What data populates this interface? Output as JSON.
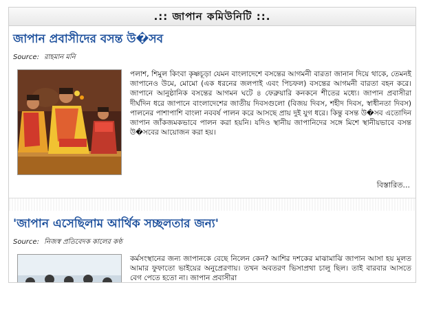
{
  "section": {
    "title": ".:: জাপান কমিউনিটি ::."
  },
  "articles": [
    {
      "title": "জাপান প্রবাসীদের বসন্ত উ�সব",
      "source_label": "Source:",
      "source_name": "রাহমান মনি",
      "body": "পলাশ, শিমুল কিংবা কৃষ্ণচূড়া যেমন বাংলাদেশে বসন্তের আগমনী বারতা জানান দিয়ে থাকে, তেমনই জাপানেও উমে, মোমো (এক ধরনের জলপাই এবং পিচফল) বসন্তের আগমনী বারতা বহন করে। জাপানে আনুষ্ঠানিক বসন্তের আগমন ঘটে ৪ ফেব্রুয়ারি কনকনে শীতের মধ্যে। জাপান প্রবাসীরা দীর্ঘদিন ধরে জাপানে বাংলাদেশের জাতীয় দিবসগুলো (বিজয় দিবস, শহীদ দিবস, স্বাধীনতা দিবস) পালনের পাশাপাশি বাংলা নববর্ষ পালন করে আসছে প্রায় দুই যুগ ধরে। কিন্তু বসন্ত উ�সব এতোদিন জাপান জাঁকজমকভাবে পালন করা হয়নি। যদিও স্থানীয় জাপানিদের সঙ্গে মিশে স্থানীয়ভাবে বসন্ত উ�সবের আয়োজন করা হয়।",
      "more": "বিস্তারিত..."
    },
    {
      "title": "'জাপান এসেছিলাম আর্থিক সচ্ছলতার জন্য'",
      "source_label": "Source:",
      "source_name": "নিজস্ব প্রতিবেদক কালের কণ্ঠ",
      "body": "কর্মসংস্থানের জন্য জাপানকে বেছে নিলেন কেন? আশির দশকের মাঝামাঝি জাপান আসা হয় মূলত আমার ফুফাতো ভাইয়ের অনুপ্রেরণায়। তখন অবতরণ ভিসাপ্রথা চালু ছিল। তাই বারবার আসতে বেগ পেতে হতো না। জাপান প্রবাসীরা"
    }
  ]
}
